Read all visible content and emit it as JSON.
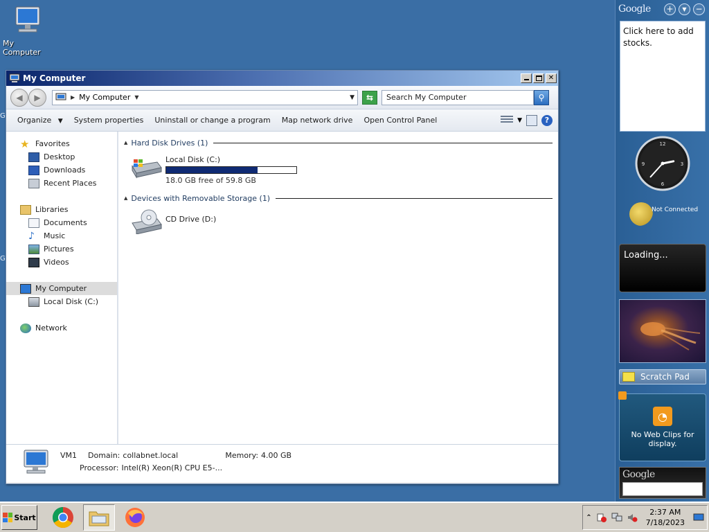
{
  "desktop": {
    "icons": [
      {
        "label": "My Computer",
        "icon": "computer-icon"
      }
    ]
  },
  "window": {
    "title": "My Computer",
    "controls": {
      "minimize": "_",
      "maximize": "□",
      "close": "✕"
    },
    "address": {
      "location": "My Computer"
    },
    "search": {
      "placeholder": "Search My Computer"
    },
    "toolbar": {
      "organize": "Organize",
      "items": [
        "System properties",
        "Uninstall or change a program",
        "Map network drive",
        "Open Control Panel"
      ]
    },
    "navpane": {
      "favorites": {
        "label": "Favorites",
        "items": [
          "Desktop",
          "Downloads",
          "Recent Places"
        ]
      },
      "libraries": {
        "label": "Libraries",
        "items": [
          "Documents",
          "Music",
          "Pictures",
          "Videos"
        ]
      },
      "computer": {
        "label": "My Computer",
        "items": [
          "Local Disk (C:)"
        ]
      },
      "network": {
        "label": "Network"
      }
    },
    "content": {
      "hdd_section": "Hard Disk Drives (1)",
      "local_disk": {
        "name": "Local Disk (C:)",
        "free_text": "18.0 GB free of 59.8 GB",
        "used_fraction": 0.7
      },
      "removable_section": "Devices with Removable Storage (1)",
      "cd_drive": {
        "name": "CD Drive (D:)"
      }
    },
    "details": {
      "name": "VM1",
      "domain_label": "Domain:",
      "domain_value": "collabnet.local",
      "memory_label": "Memory:",
      "memory_value": "4.00 GB",
      "processor_label": "Processor:",
      "processor_value": "Intel(R) Xeon(R) CPU E5-..."
    }
  },
  "sidebar": {
    "header": "Google",
    "stocks_text": "Click here to add stocks.",
    "weather_status": "Not Connected",
    "loading_text": "Loading...",
    "scratch_pad": "Scratch Pad",
    "webclips_text": "No Web Clips for display.",
    "google_search_header": "Google",
    "clock": {
      "hour": 2,
      "minute": 37
    }
  },
  "taskbar": {
    "start_label": "Start",
    "time": "2:37 AM",
    "date": "7/18/2023"
  },
  "colors": {
    "desktop_bg": "#3a6ea5",
    "progress_fill": "#0f2a73"
  }
}
